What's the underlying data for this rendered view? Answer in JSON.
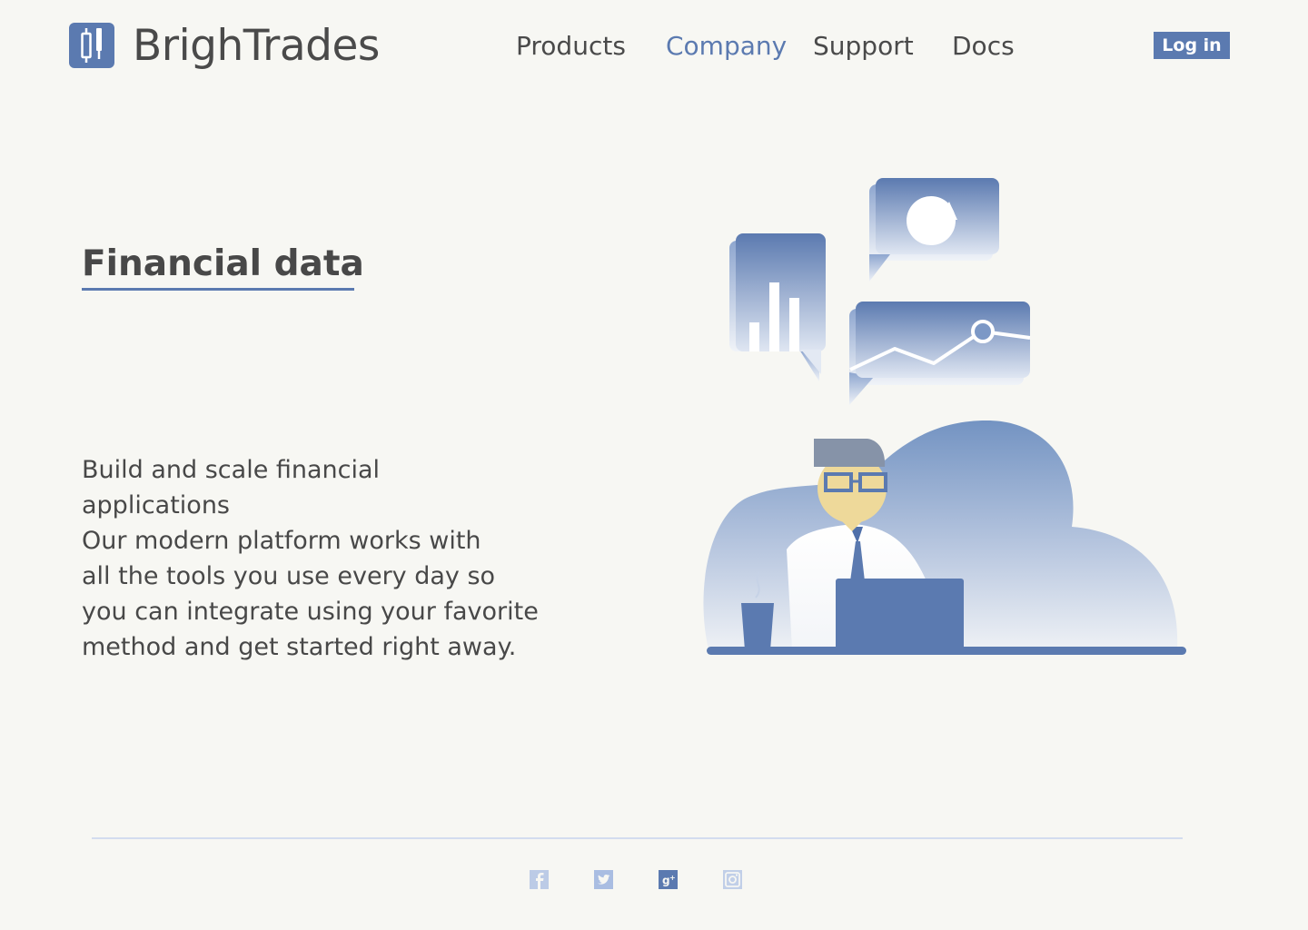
{
  "brand": {
    "name": "BrighTrades",
    "logo_icon": "candlestick-logo-icon",
    "accent_color": "#5b7ab0"
  },
  "nav": {
    "items": [
      {
        "label": "Products",
        "active": false
      },
      {
        "label": "Company",
        "active": true
      },
      {
        "label": "Support",
        "active": false
      },
      {
        "label": "Docs",
        "active": false
      }
    ],
    "login_label": "Log in"
  },
  "hero": {
    "title": "Financial data",
    "paragraphs": [
      "Build and scale financial\napplications",
      "Our modern platform works with\nall the tools you use every day so\nyou can integrate using your favorite\nmethod and get started right away."
    ],
    "illustration": "trader-at-laptop-illustration"
  },
  "footer": {
    "social_icons": [
      "facebook-icon",
      "twitter-icon",
      "google-plus-icon",
      "instagram-icon"
    ]
  }
}
